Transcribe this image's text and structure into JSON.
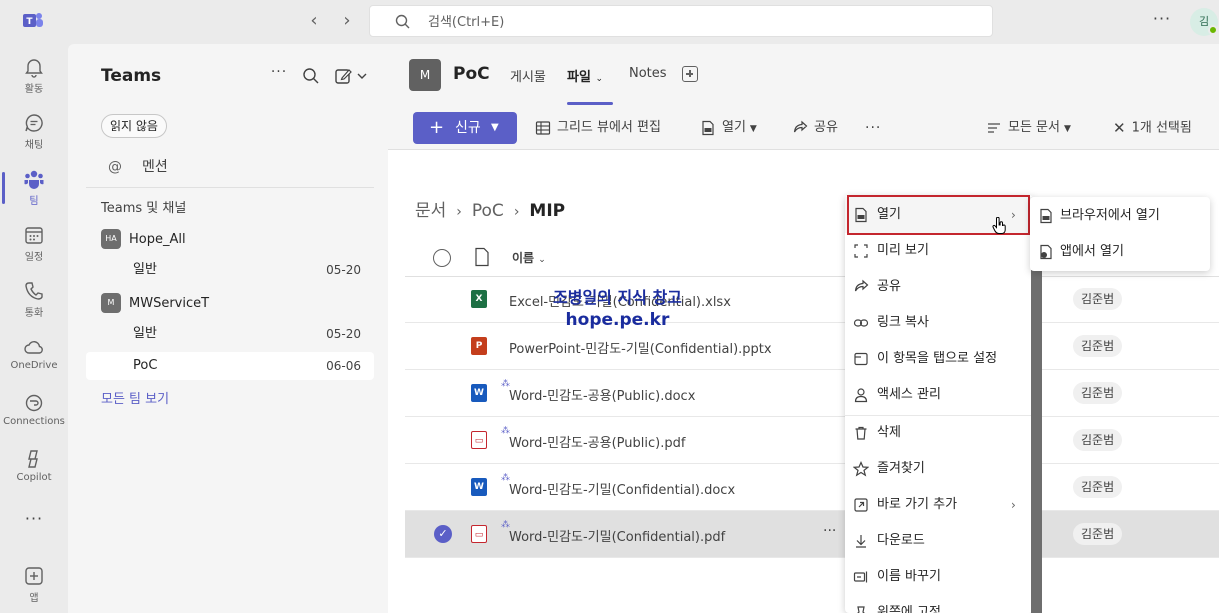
{
  "search": {
    "placeholder": "검색(Ctrl+E)"
  },
  "me": {
    "initial": "김"
  },
  "rail": [
    {
      "label": "활동",
      "icon": "bell-icon"
    },
    {
      "label": "채팅",
      "icon": "chat-icon"
    },
    {
      "label": "팀",
      "icon": "teams-icon"
    },
    {
      "label": "일정",
      "icon": "calendar-icon"
    },
    {
      "label": "통화",
      "icon": "phone-icon"
    },
    {
      "label": "OneDrive",
      "icon": "cloud-icon"
    },
    {
      "label": "Connections",
      "icon": "connections-icon"
    },
    {
      "label": "Copilot",
      "icon": "copilot-icon"
    },
    {
      "label": "앱",
      "icon": "add-app-icon"
    }
  ],
  "leftpane": {
    "title": "Teams",
    "filter_chip": "읽지 않음",
    "mention_label": "멘션",
    "section_title": "Teams 및 채널",
    "teams": [
      {
        "initials": "HA",
        "name": "Hope_All",
        "channels": [
          {
            "name": "일반",
            "date": "05-20"
          }
        ]
      },
      {
        "initials": "M",
        "name": "MWServiceT",
        "channels": [
          {
            "name": "일반",
            "date": "05-20"
          },
          {
            "name": "PoC",
            "date": "06-06"
          }
        ]
      }
    ],
    "see_all": "모든 팀 보기"
  },
  "channel": {
    "initial": "M",
    "name": "PoC",
    "tabs": [
      "게시물",
      "파일",
      "Notes"
    ]
  },
  "toolbar": {
    "new_label": "신규",
    "grid_edit": "그리드 뷰에서 편집",
    "open": "열기",
    "share": "공유",
    "view": "모든 문서",
    "selected": "1개 선택됨"
  },
  "breadcrumb": [
    "문서",
    "PoC",
    "MIP"
  ],
  "columns": {
    "name": "이름"
  },
  "files": [
    {
      "type": "xlsx",
      "name": "Excel-민감도-기밀(Confidential).xlsx",
      "owner": "김준범",
      "new": false,
      "selected": false
    },
    {
      "type": "pptx",
      "name": "PowerPoint-민감도-기밀(Confidential).pptx",
      "owner": "김준범",
      "new": false,
      "selected": false
    },
    {
      "type": "docx",
      "name": "Word-민감도-공용(Public).docx",
      "owner": "김준범",
      "new": true,
      "selected": false
    },
    {
      "type": "pdf",
      "name": "Word-민감도-공용(Public).pdf",
      "owner": "김준범",
      "new": true,
      "selected": false
    },
    {
      "type": "docx",
      "name": "Word-민감도-기밀(Confidential).docx",
      "owner": "김준범",
      "new": true,
      "selected": false
    },
    {
      "type": "pdf",
      "name": "Word-민감도-기밀(Confidential).pdf",
      "owner": "김준범",
      "new": true,
      "selected": true
    }
  ],
  "context_menu": [
    {
      "label": "열기",
      "icon": "document-icon",
      "submenu": true
    },
    {
      "label": "미리 보기",
      "icon": "preview-icon",
      "submenu": false
    },
    {
      "label": "공유",
      "icon": "share-icon",
      "submenu": false
    },
    {
      "label": "링크 복사",
      "icon": "link-icon",
      "submenu": false
    },
    {
      "label": "이 항목을 탭으로 설정",
      "icon": "tab-icon",
      "submenu": false
    },
    {
      "label": "액세스 관리",
      "icon": "person-icon",
      "submenu": false
    },
    {
      "label": "삭제",
      "icon": "trash-icon",
      "submenu": false
    },
    {
      "label": "즐겨찾기",
      "icon": "star-icon",
      "submenu": false
    },
    {
      "label": "바로 가기 추가",
      "icon": "shortcut-icon",
      "submenu": true
    },
    {
      "label": "다운로드",
      "icon": "download-icon",
      "submenu": false
    },
    {
      "label": "이름 바꾸기",
      "icon": "rename-icon",
      "submenu": false
    },
    {
      "label": "위쪽에 고정",
      "icon": "pin-icon",
      "submenu": false
    }
  ],
  "submenu": [
    {
      "label": "브라우저에서 열기",
      "icon": "document-icon"
    },
    {
      "label": "앱에서 열기",
      "icon": "app-open-icon"
    }
  ],
  "watermark": {
    "line1": "조병일의 지식 창고",
    "line2": "hope.pe.kr"
  },
  "colors": {
    "accent": "#5b5fc7",
    "highlight_box": "#c4262e",
    "watermark": "#1a2c9e"
  }
}
